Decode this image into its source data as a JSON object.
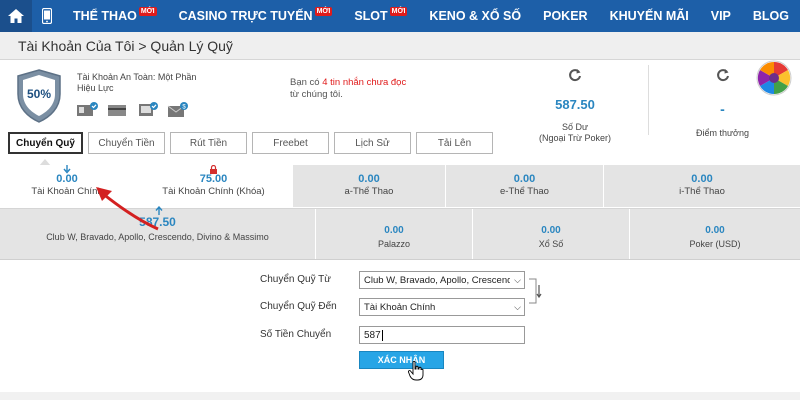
{
  "nav": {
    "items": [
      {
        "label": "THỂ THAO",
        "badge": "MỚI"
      },
      {
        "label": "CASINO TRỰC TUYẾN",
        "badge": "MỚI"
      },
      {
        "label": "SLOT",
        "badge": "MỚI"
      },
      {
        "label": "KENO & XỔ SỐ",
        "badge": ""
      },
      {
        "label": "POKER",
        "badge": ""
      },
      {
        "label": "KHUYẾN MÃI",
        "badge": ""
      },
      {
        "label": "VIP",
        "badge": ""
      },
      {
        "label": "BLOG",
        "badge": ""
      }
    ]
  },
  "breadcrumb": "Tài Khoản Của Tôi > Quản Lý Quỹ",
  "account": {
    "percent": "50%",
    "safety_line1": "Tài Khoản An Toàn: Một Phần",
    "safety_line2": "Hiệu Lực",
    "msg_prefix": "Bạn có",
    "msg_count": "4 tin nhắn chưa đọc",
    "msg_suffix": "từ chúng tôi."
  },
  "balance": {
    "value": "587.50",
    "label1": "Số Dư",
    "label2": "(Ngoại Trừ Poker)"
  },
  "points": {
    "value": "-",
    "label": "Điểm thưởng"
  },
  "tabs": [
    "Chuyển Quỹ",
    "Chuyển Tiền",
    "Rút Tiền",
    "Freebet",
    "Lịch Sử",
    "Tải Lên"
  ],
  "wallets_row1": [
    {
      "value": "0.00",
      "label": "Tài Khoản Chính"
    },
    {
      "value": "75.00",
      "label": "Tài Khoản Chính (Khóa)"
    },
    {
      "value": "0.00",
      "label": "a-Thể Thao"
    },
    {
      "value": "0.00",
      "label": "e-Thể Thao"
    },
    {
      "value": "0.00",
      "label": "i-Thể Thao"
    }
  ],
  "wallets_row2": [
    {
      "value": "587.50",
      "label": "Club W, Bravado, Apollo, Crescendo, Divino & Massimo"
    },
    {
      "value": "0.00",
      "label": "Palazzo"
    },
    {
      "value": "0.00",
      "label": "Xổ Số"
    },
    {
      "value": "0.00",
      "label": "Poker (USD)"
    }
  ],
  "form": {
    "from_label": "Chuyển Quỹ Từ",
    "from_value": "Club W, Bravado, Apollo, Crescendo, Divino & Massimo",
    "to_label": "Chuyển Quỹ Đến",
    "to_value": "Tài Khoản Chính",
    "amount_label": "Số Tiền Chuyển",
    "amount_value": "587",
    "confirm_label": "XÁC NHẬN"
  },
  "colors": {
    "nav": "#1d5fa8",
    "accent": "#2a86c0",
    "confirm": "#27a5e6",
    "alert": "#e01b1b"
  }
}
